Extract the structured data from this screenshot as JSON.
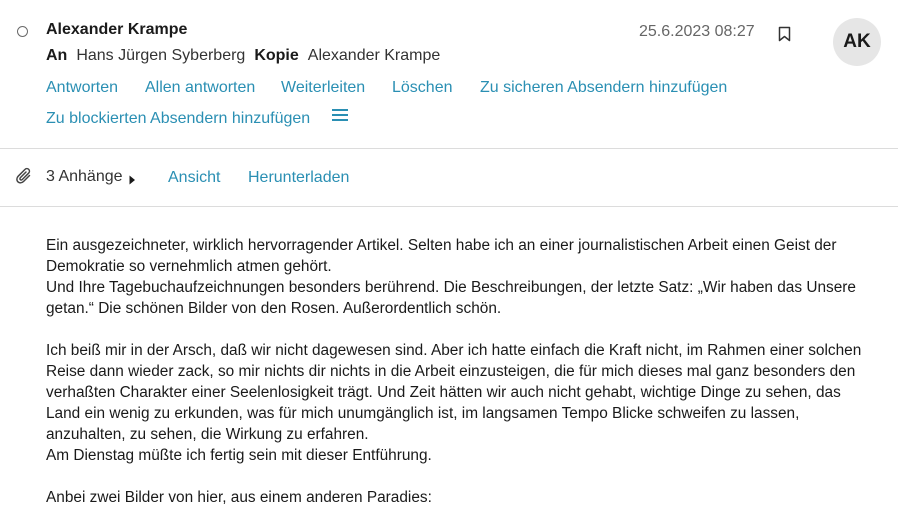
{
  "message": {
    "sender": "Alexander Krampe",
    "to_label": "An",
    "to": "Hans Jürgen Syberberg",
    "cc_label": "Kopie",
    "cc": "Alexander Krampe",
    "date": "25.6.2023 08:27",
    "avatar_initials": "AK"
  },
  "actions": {
    "reply": "Antworten",
    "reply_all": "Allen antworten",
    "forward": "Weiterleiten",
    "delete": "Löschen",
    "add_safe_sender": "Zu sicheren Absendern hinzufügen",
    "add_blocked_sender": "Zu blockierten Absendern hinzufügen"
  },
  "attachments": {
    "count_label": "3 Anhänge",
    "view": "Ansicht",
    "download": "Herunterladen"
  },
  "body": {
    "p1_line1": "Ein ausgezeichneter, wirklich hervorragender Artikel. Selten habe ich an einer journalistischen Arbeit einen Geist der Demokratie so vernehmlich atmen gehört.",
    "p1_line2": "Und Ihre Tagebuchaufzeichnungen besonders berührend. Die Beschreibungen, der letzte Satz: „Wir haben das Unsere getan.“ Die schönen Bilder von den Rosen. Außerordentlich schön.",
    "p2_line1": "Ich beiß mir in der Arsch, daß wir nicht dagewesen sind. Aber ich hatte einfach die Kraft nicht, im Rahmen einer solchen Reise dann wieder zack, so mir nichts dir nichts in die Arbeit einzusteigen, die für mich dieses mal ganz besonders den verhaßten Charakter einer Seelenlosigkeit trägt. Und Zeit hätten wir auch nicht gehabt, wichtige Dinge zu sehen, das Land ein wenig zu erkunden, was für mich unumgänglich ist, im langsamen Tempo Blicke schweifen zu lassen, anzuhalten, zu sehen, die Wirkung zu erfahren.",
    "p2_line2": "Am Dienstag müßte ich fertig sein mit dieser Entführung.",
    "p3_line1": "Anbei zwei Bilder von hier, aus einem anderen Paradies:"
  },
  "icons": {
    "select": "radio-circle-icon",
    "bookmark": "bookmark-icon",
    "more": "hamburger-menu-icon",
    "attachment": "paperclip-icon",
    "expand": "caret-right-icon"
  },
  "colors": {
    "link": "#2a8fb3",
    "avatar_bg": "#e6e6e6",
    "divider": "#dcdcdc",
    "date_text": "#666666"
  }
}
